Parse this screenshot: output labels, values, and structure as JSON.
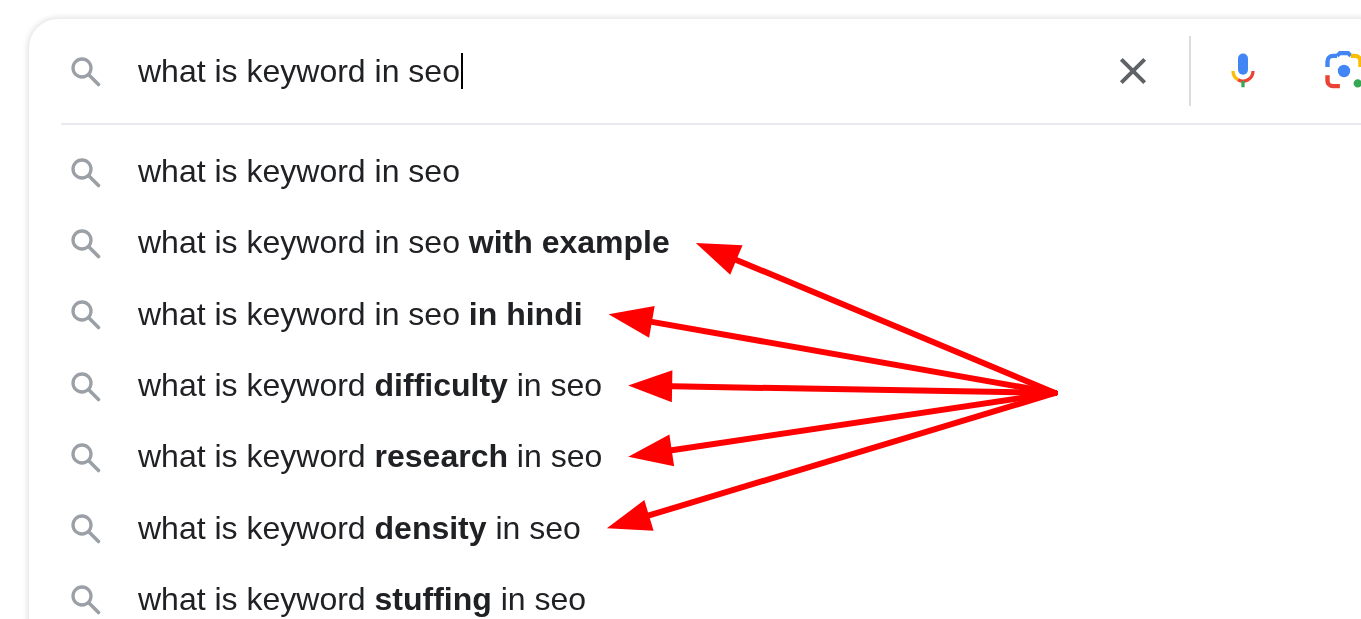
{
  "search_box": {
    "value": "what is keyword in seo"
  },
  "suggestions": [
    {
      "text": "what is keyword in seo",
      "arrow": false
    },
    {
      "text": "what is keyword in seo **with example**",
      "arrow": true
    },
    {
      "text": "what is keyword in seo **in hindi**",
      "arrow": true
    },
    {
      "text": "what is keyword **difficulty** in seo",
      "arrow": true
    },
    {
      "text": "what is keyword **research** in seo",
      "arrow": true
    },
    {
      "text": "what is keyword **density** in seo",
      "arrow": true
    },
    {
      "text": "what is keyword **stuffing** in seo",
      "arrow": false
    }
  ]
}
